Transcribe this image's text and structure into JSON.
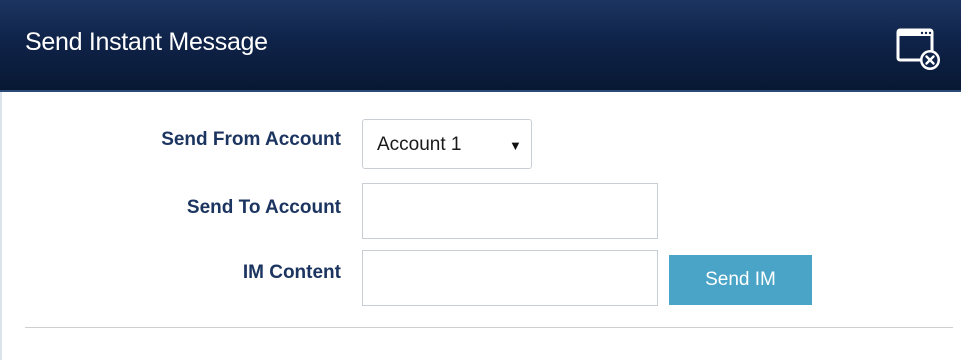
{
  "window": {
    "title": "Send Instant Message",
    "close_icon": "window-close-icon"
  },
  "form": {
    "send_from": {
      "label": "Send From Account",
      "selected": "Account 1",
      "arrow": "▼"
    },
    "send_to": {
      "label": "Send To Account",
      "value": ""
    },
    "im_content": {
      "label": "IM Content",
      "value": ""
    },
    "send_button_label": "Send IM"
  },
  "colors": {
    "titlebar": "#0f2349",
    "label_text": "#1c3560",
    "button_bg": "#4aa4c7"
  }
}
